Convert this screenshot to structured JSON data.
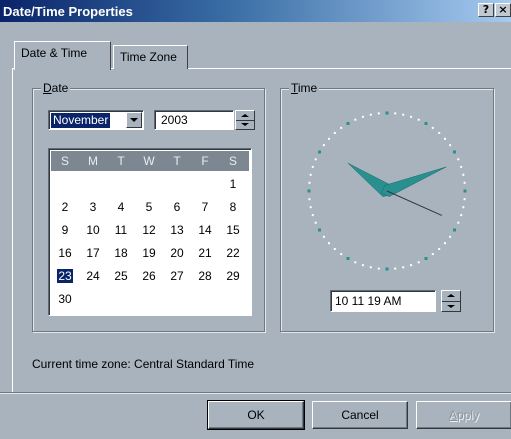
{
  "window": {
    "title": "Date/Time Properties",
    "help_label": "?",
    "close_label": "×"
  },
  "tabs": [
    {
      "label": "Date & Time",
      "active": true
    },
    {
      "label": "Time Zone",
      "active": false
    }
  ],
  "date_group": {
    "label_access_key": "D",
    "label_rest": "ate",
    "month": "November",
    "year": "2003"
  },
  "calendar": {
    "weekday_headers": [
      "S",
      "M",
      "T",
      "W",
      "T",
      "F",
      "S"
    ],
    "days": [
      "1",
      "2",
      "3",
      "4",
      "5",
      "6",
      "7",
      "8",
      "9",
      "10",
      "11",
      "12",
      "13",
      "14",
      "15",
      "16",
      "17",
      "18",
      "19",
      "20",
      "21",
      "22",
      "23",
      "24",
      "25",
      "26",
      "27",
      "28",
      "29",
      "30"
    ],
    "first_weekday_index": 6,
    "selected_day": "23"
  },
  "time_group": {
    "label_access_key": "T",
    "label_rest": "ime",
    "time_value": "10 11 19 AM",
    "clock": {
      "hour": 10,
      "minute": 11,
      "second": 19
    }
  },
  "timezone_text": "Current time zone:  Central Standard Time",
  "buttons": {
    "ok": "OK",
    "cancel": "Cancel",
    "apply_access_key": "A",
    "apply_rest": "pply"
  },
  "colors": {
    "dialog_bg": "#a8b3bd",
    "selection": "#0a246a",
    "clock_hands": "#2a8f8f"
  }
}
